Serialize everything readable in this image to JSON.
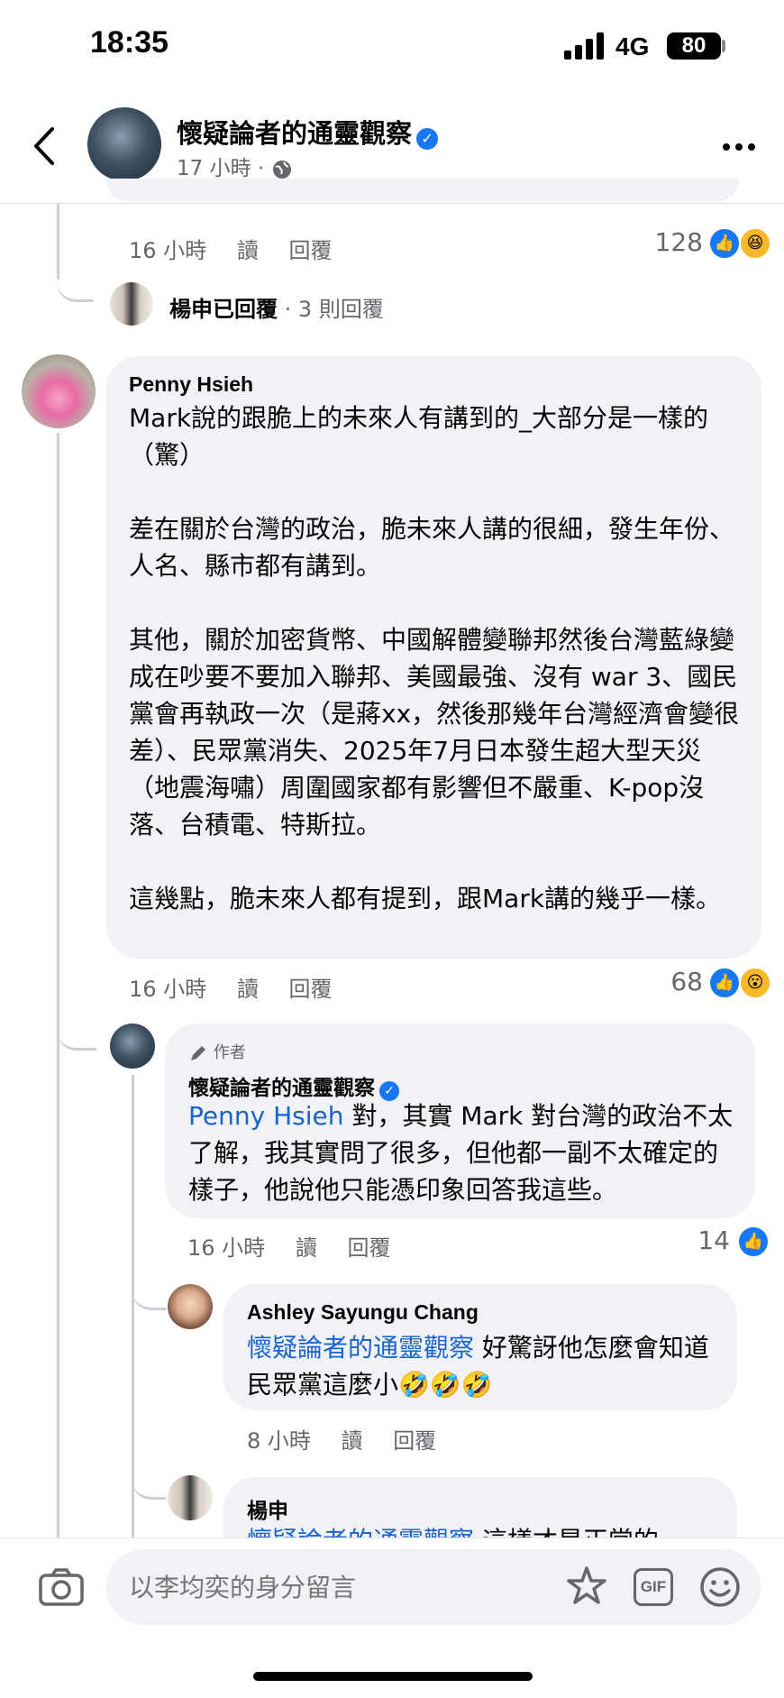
{
  "status_bar": {
    "time": "18:35",
    "network": "4G",
    "battery": "80"
  },
  "header": {
    "page_name": "懷疑論者的通靈觀察",
    "post_time": "17 小時",
    "separator": "·",
    "back_icon": "chevron-left-icon",
    "globe_icon": "globe-icon",
    "more_icon": "more-horizontal-icon"
  },
  "top_comment": {
    "time": "16 小時",
    "like_label": "讀",
    "reply_label": "回覆",
    "reaction_count": "128",
    "reactions": [
      "like",
      "haha"
    ],
    "replied_summary": {
      "name": "楊申",
      "action": "已回覆",
      "separator": "·",
      "count_text": "3 則回覆"
    }
  },
  "comments": [
    {
      "name": "Penny Hsieh",
      "text": "Mark說的跟脆上的未來人有講到的_大部分是一樣的（驚）\n\n差在關於台灣的政治，脆未來人講的很細，發生年份、人名、縣市都有講到。\n\n其他，關於加密貨幣、中國解體變聯邦然後台灣藍綠變成在吵要不要加入聯邦、美國最強、沒有 war 3、國民黨會再執政一次（是蔣xx，然後那幾年台灣經濟會變很差）、民眾黨消失、2025年7月日本發生超大型天災（地震海嘯）周圍國家都有影響但不嚴重、K-pop沒落、台積電、特斯拉。\n\n這幾點，脆未來人都有提到，跟Mark講的幾乎一樣。",
      "time": "16 小時",
      "like_label": "讀",
      "reply_label": "回覆",
      "reaction_count": "68",
      "reactions": [
        "like",
        "wow"
      ]
    },
    {
      "author_badge": "作者",
      "name": "懷疑論者的通靈觀察",
      "mention": "Penny Hsieh",
      "text": " 對，其實 Mark 對台灣的政治不太了解，我其實問了很多，但他都一副不太確定的樣子，他說他只能憑印象回答我這些。",
      "time": "16 小時",
      "like_label": "讀",
      "reply_label": "回覆",
      "reaction_count": "14",
      "reactions": [
        "like"
      ]
    },
    {
      "name": "Ashley Sayungu Chang",
      "mention": "懷疑論者的通靈觀察",
      "text": " 好驚訝他怎麼會知道民眾黨這麼小🤣🤣🤣",
      "time": "8 小時",
      "like_label": "讀",
      "reply_label": "回覆"
    },
    {
      "name": "楊申",
      "mention": "懷疑論者的通靈觀察",
      "text": " 這樣才是正常的，"
    }
  ],
  "composer": {
    "placeholder": "以李均奕的身分留言",
    "camera_icon": "camera-icon",
    "sticker_icon": "sticker-icon",
    "gif_label": "GIF",
    "emoji_icon": "smiley-icon"
  },
  "colors": {
    "accent": "#1877f2",
    "bubble": "#f0f2f5",
    "meta": "#65676b",
    "mention": "#1763cf"
  }
}
